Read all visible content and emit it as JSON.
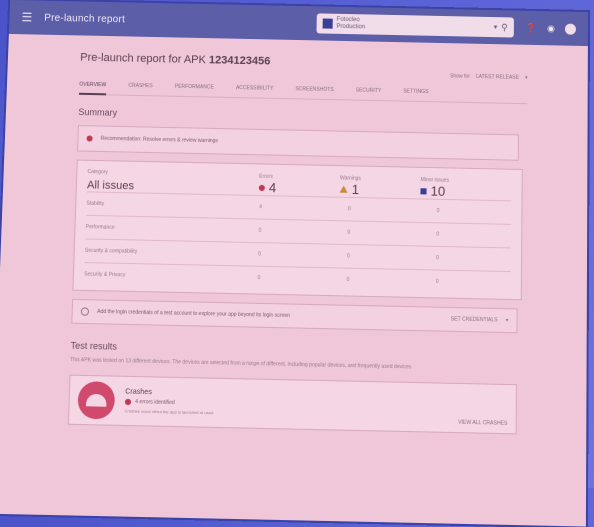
{
  "appbar": {
    "title": "Pre-launch report",
    "app_name": "Fotocleo",
    "app_sub": "Production"
  },
  "page": {
    "title_prefix": "Pre-launch report for APK",
    "apk_id": "1234123456",
    "show_label": "Show for",
    "show_value": "LATEST RELEASE"
  },
  "tabs": [
    "OVERVIEW",
    "CRASHES",
    "PERFORMANCE",
    "ACCESSIBILITY",
    "SCREENSHOTS",
    "SECURITY",
    "SETTINGS"
  ],
  "summary": {
    "section_title": "Summary",
    "alert_text": "Recommendation: Resolve errors & review warnings",
    "category_label": "Category",
    "all_issues": "All issues",
    "errors_label": "Errors",
    "errors_value": "4",
    "warnings_label": "Warnings",
    "warnings_value": "1",
    "minor_label": "Minor issues",
    "minor_value": "10",
    "rows": [
      {
        "cat": "Stability",
        "e": "4",
        "w": "0",
        "m": "0"
      },
      {
        "cat": "Performance",
        "e": "0",
        "w": "0",
        "m": "0"
      },
      {
        "cat": "Security & compatibility",
        "e": "0",
        "w": "0",
        "m": "0"
      },
      {
        "cat": "Security & Privacy",
        "e": "0",
        "w": "0",
        "m": "0"
      }
    ]
  },
  "notice": {
    "text": "Add the login credentials of a test account to explore your app beyond its login screen",
    "action": "SET CREDENTIALS"
  },
  "results": {
    "title": "Test results",
    "description": "This APK was tested on 13 different devices. The devices are selected from a range of different, including popular devices, and frequently used devices"
  },
  "crashes": {
    "title": "Crashes",
    "issue": "4 errors identified",
    "detail": "Crashes occur when the app is launched or used",
    "link": "VIEW ALL CRASHES"
  }
}
